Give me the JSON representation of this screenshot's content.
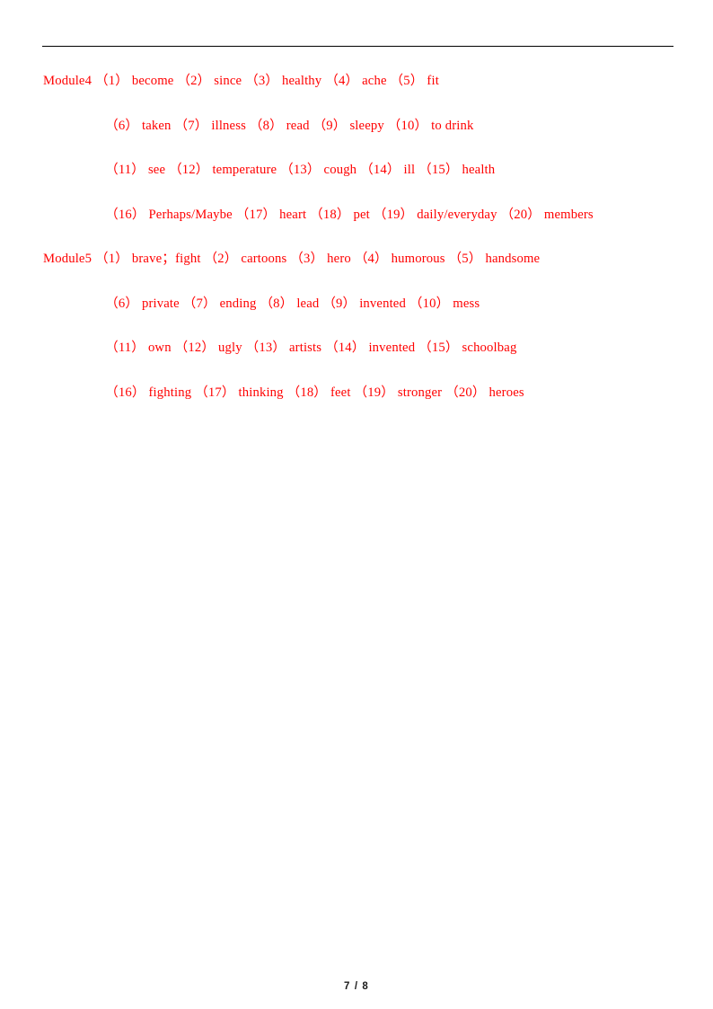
{
  "document": {
    "page_number_label": "7 / 8"
  },
  "header": {
    "rule_color": "#000000"
  },
  "theme": {
    "answer_color": "#ff0000",
    "page_background": "#ffffff",
    "footer_color": "#1a1a1a"
  },
  "content": {
    "sections": [
      {
        "id": "module4",
        "lines": [
          {
            "indented": false,
            "text": "Module4 （1） become （2） since （3） healthy （4） ache （5） fit"
          },
          {
            "indented": true,
            "text": "（6） taken （7） illness （8） read （9） sleepy （10） to drink"
          },
          {
            "indented": true,
            "text": "（11） see （12） temperature （13） cough （14） ill （15） health"
          },
          {
            "indented": true,
            "text": "（16） Perhaps/Maybe （17） heart （18） pet （19） daily/everyday （20） members"
          }
        ]
      },
      {
        "id": "module5",
        "lines": [
          {
            "indented": false,
            "text": "Module5 （1） brave；fight （2） cartoons （3） hero （4） humorous （5） handsome"
          },
          {
            "indented": true,
            "text": "（6） private （7） ending （8） lead （9） invented （10） mess"
          },
          {
            "indented": true,
            "text": "（11） own （12） ugly （13） artists （14） invented （15） schoolbag"
          },
          {
            "indented": true,
            "text": "（16） fighting （17） thinking （18） feet （19） stronger （20） heroes"
          }
        ]
      }
    ]
  }
}
